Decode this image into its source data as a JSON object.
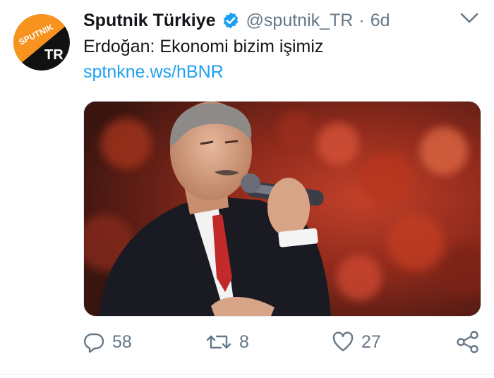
{
  "author": {
    "display_name": "Sputnik Türkiye",
    "handle": "@sputnik_TR",
    "separator": "·",
    "time": "6d",
    "verified": true,
    "avatar": {
      "logo_text_top": "SPUTNIK",
      "logo_text_bottom": "TR",
      "orange": "#f7931e",
      "black": "#111111"
    }
  },
  "tweet": {
    "text": "Erdoğan: Ekonomi bizim işimiz",
    "link": "sptnkne.ws/hBNR"
  },
  "media": {
    "icon": "photo-image"
  },
  "actions": {
    "reply_count": "58",
    "retweet_count": "8",
    "like_count": "27"
  },
  "colors": {
    "text_primary": "#14171a",
    "text_secondary": "#657786",
    "link": "#1da1f2",
    "verified": "#1da1f2"
  },
  "icons": {
    "verified": "verified-badge-icon",
    "menu": "chevron-down-icon",
    "reply": "reply-icon",
    "retweet": "retweet-icon",
    "like": "heart-icon",
    "share": "share-icon"
  }
}
